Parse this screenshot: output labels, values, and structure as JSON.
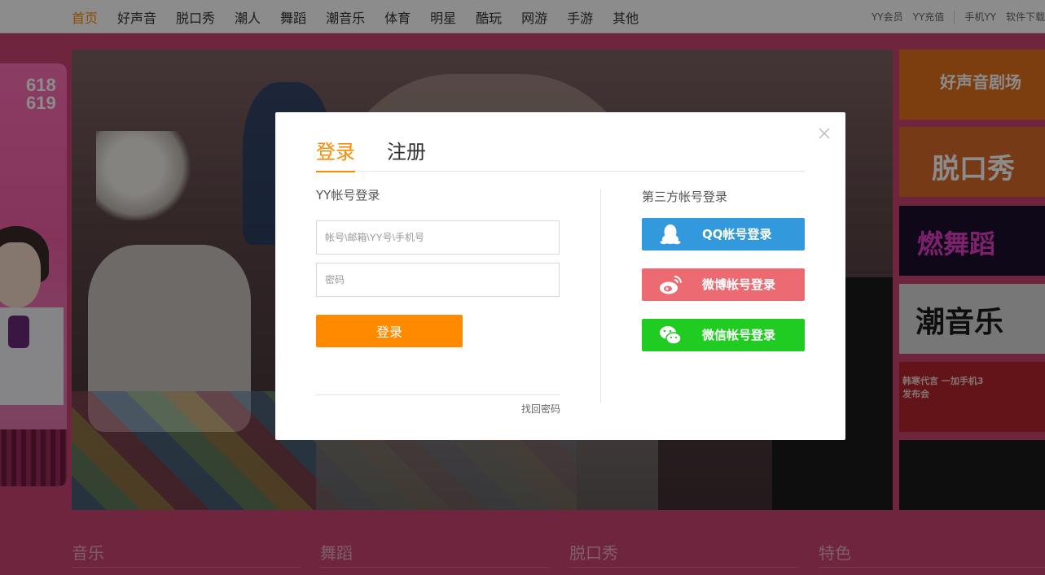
{
  "nav": {
    "items": [
      "首页",
      "好声音",
      "脱口秀",
      "潮人",
      "舞蹈",
      "潮音乐",
      "体育",
      "明星",
      "酷玩",
      "网游",
      "手游",
      "其他"
    ],
    "right": [
      "YY会员",
      "YY充值",
      "手机YY",
      "软件下载"
    ]
  },
  "background": {
    "left_poster": {
      "text": "618 619"
    },
    "thumbnails": [
      "好声音剧场",
      "脱口秀",
      "燃舞蹈",
      "潮音乐",
      "韩寒代言 一加手机3发布会",
      ""
    ],
    "sections": [
      "音乐",
      "舞蹈",
      "脱口秀",
      "特色"
    ]
  },
  "modal": {
    "tabs": {
      "login": "登录",
      "register": "注册"
    },
    "yy_title": "YY帐号登录",
    "account_placeholder": "帐号\\邮箱\\YY号\\手机号",
    "password_placeholder": "密码",
    "login_button": "登录",
    "forgot_password": "找回密码",
    "third_party_title": "第三方帐号登录",
    "qq_button": "QQ帐号登录",
    "weibo_button": "微博帐号登录",
    "wechat_button": "微信帐号登录"
  },
  "colors": {
    "accent": "#ff8a00",
    "qq": "#3399dd",
    "weibo": "#ec6b72",
    "wechat": "#21cc22"
  }
}
